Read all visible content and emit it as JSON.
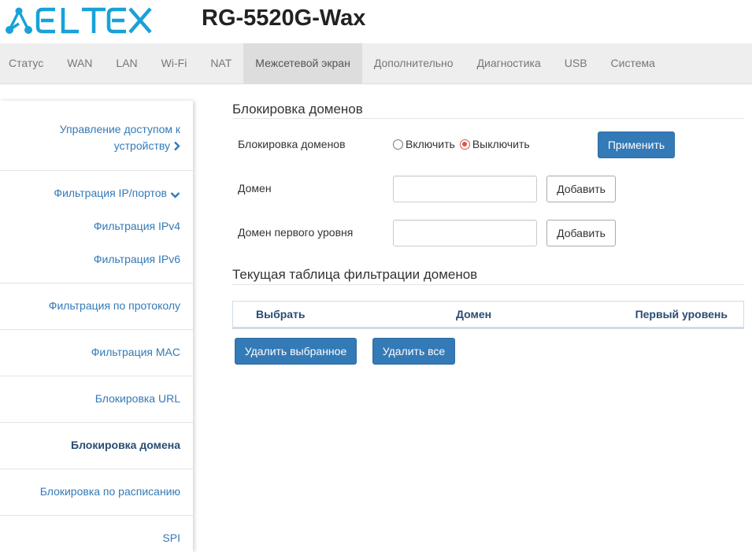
{
  "brand": {
    "logo_text": "ELTEX",
    "logo_color": "#17a2d8",
    "model": "RG-5520G-Wax"
  },
  "topnav": {
    "tabs": [
      {
        "label": "Статус"
      },
      {
        "label": "WAN"
      },
      {
        "label": "LAN"
      },
      {
        "label": "Wi-Fi"
      },
      {
        "label": "NAT"
      },
      {
        "label": "Межсетевой экран",
        "active": true
      },
      {
        "label": "Дополнительно"
      },
      {
        "label": "Диагностика"
      },
      {
        "label": "USB"
      },
      {
        "label": "Система"
      }
    ]
  },
  "sidebar": {
    "items": [
      {
        "label_line1": "Управление доступом к",
        "label_line2": "устройству",
        "icon": "chevron-right-icon"
      },
      {
        "label": "Фильтрация IP/портов",
        "icon": "chevron-down-icon"
      },
      {
        "label": "Фильтрация IPv4"
      },
      {
        "label": "Фильтрация IPv6"
      },
      {
        "label": "Фильтрация по протоколу"
      },
      {
        "label": "Фильтрация MAC"
      },
      {
        "label": "Блокировка URL"
      },
      {
        "label": "Блокировка домена",
        "active": true
      },
      {
        "label": "Блокировка по расписанию"
      },
      {
        "label": "SPI"
      }
    ]
  },
  "main": {
    "section1_title": "Блокировка доменов",
    "block_label": "Блокировка доменов",
    "radio_on": "Включить",
    "radio_off": "Выключить",
    "selected_radio": "off",
    "apply_button": "Применить",
    "domain_label": "Домен",
    "domain_value": "",
    "domain_add": "Добавить",
    "tld_label": "Домен первого уровня",
    "tld_value": "",
    "tld_add": "Добавить",
    "section2_title": "Текущая таблица фильтрации доменов",
    "table": {
      "columns": [
        "Выбрать",
        "Домен",
        "Первый уровень"
      ],
      "rows": []
    },
    "delete_selected": "Удалить выбранное",
    "delete_all": "Удалить все"
  },
  "colors": {
    "primary": "#337ab7",
    "link": "#337ab7",
    "active_link": "#2a4d74",
    "radio_checked": "#d9534f",
    "nav_bg": "#eeeeee",
    "nav_active_bg": "#dddddd"
  }
}
